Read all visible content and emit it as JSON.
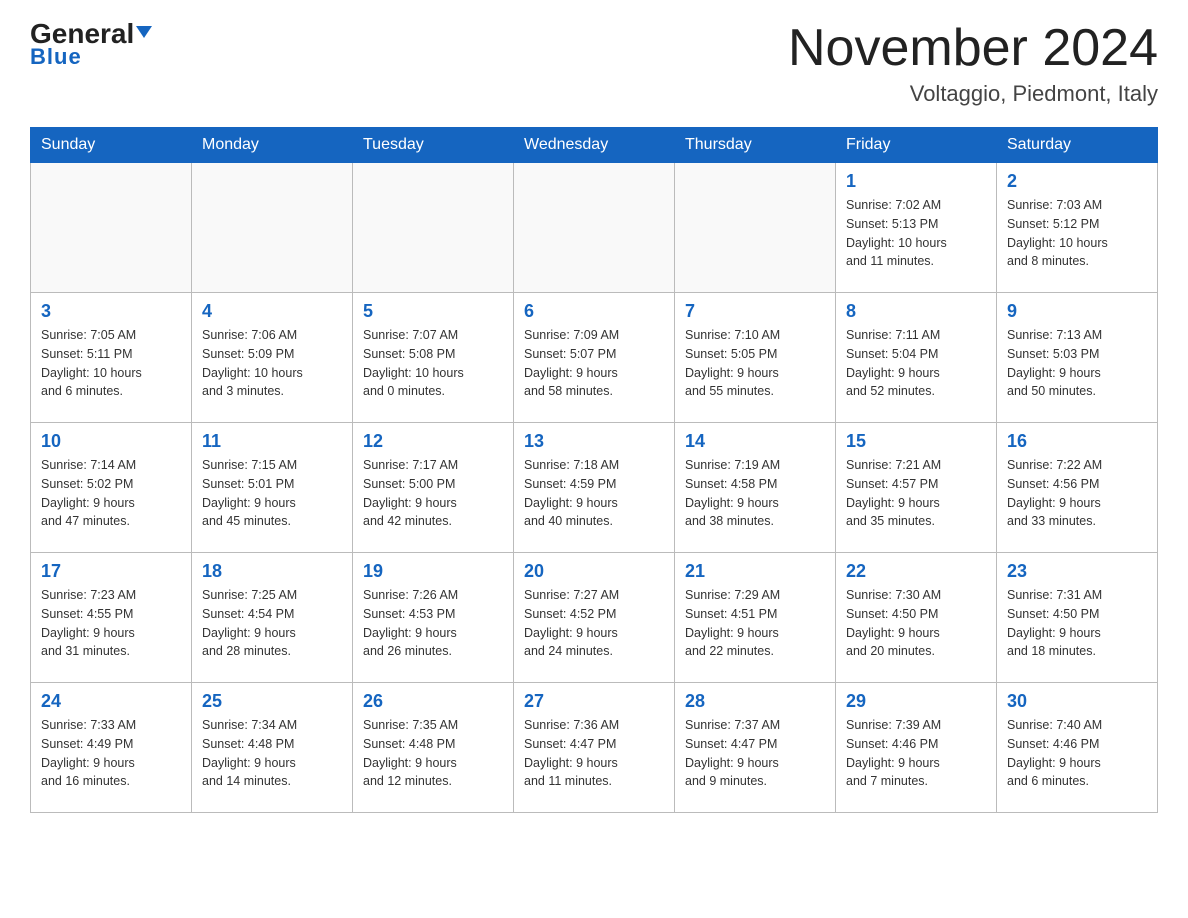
{
  "header": {
    "logo_general": "General",
    "logo_blue": "Blue",
    "month_title": "November 2024",
    "location": "Voltaggio, Piedmont, Italy"
  },
  "weekdays": [
    "Sunday",
    "Monday",
    "Tuesday",
    "Wednesday",
    "Thursday",
    "Friday",
    "Saturday"
  ],
  "weeks": [
    [
      {
        "day": "",
        "info": ""
      },
      {
        "day": "",
        "info": ""
      },
      {
        "day": "",
        "info": ""
      },
      {
        "day": "",
        "info": ""
      },
      {
        "day": "",
        "info": ""
      },
      {
        "day": "1",
        "info": "Sunrise: 7:02 AM\nSunset: 5:13 PM\nDaylight: 10 hours\nand 11 minutes."
      },
      {
        "day": "2",
        "info": "Sunrise: 7:03 AM\nSunset: 5:12 PM\nDaylight: 10 hours\nand 8 minutes."
      }
    ],
    [
      {
        "day": "3",
        "info": "Sunrise: 7:05 AM\nSunset: 5:11 PM\nDaylight: 10 hours\nand 6 minutes."
      },
      {
        "day": "4",
        "info": "Sunrise: 7:06 AM\nSunset: 5:09 PM\nDaylight: 10 hours\nand 3 minutes."
      },
      {
        "day": "5",
        "info": "Sunrise: 7:07 AM\nSunset: 5:08 PM\nDaylight: 10 hours\nand 0 minutes."
      },
      {
        "day": "6",
        "info": "Sunrise: 7:09 AM\nSunset: 5:07 PM\nDaylight: 9 hours\nand 58 minutes."
      },
      {
        "day": "7",
        "info": "Sunrise: 7:10 AM\nSunset: 5:05 PM\nDaylight: 9 hours\nand 55 minutes."
      },
      {
        "day": "8",
        "info": "Sunrise: 7:11 AM\nSunset: 5:04 PM\nDaylight: 9 hours\nand 52 minutes."
      },
      {
        "day": "9",
        "info": "Sunrise: 7:13 AM\nSunset: 5:03 PM\nDaylight: 9 hours\nand 50 minutes."
      }
    ],
    [
      {
        "day": "10",
        "info": "Sunrise: 7:14 AM\nSunset: 5:02 PM\nDaylight: 9 hours\nand 47 minutes."
      },
      {
        "day": "11",
        "info": "Sunrise: 7:15 AM\nSunset: 5:01 PM\nDaylight: 9 hours\nand 45 minutes."
      },
      {
        "day": "12",
        "info": "Sunrise: 7:17 AM\nSunset: 5:00 PM\nDaylight: 9 hours\nand 42 minutes."
      },
      {
        "day": "13",
        "info": "Sunrise: 7:18 AM\nSunset: 4:59 PM\nDaylight: 9 hours\nand 40 minutes."
      },
      {
        "day": "14",
        "info": "Sunrise: 7:19 AM\nSunset: 4:58 PM\nDaylight: 9 hours\nand 38 minutes."
      },
      {
        "day": "15",
        "info": "Sunrise: 7:21 AM\nSunset: 4:57 PM\nDaylight: 9 hours\nand 35 minutes."
      },
      {
        "day": "16",
        "info": "Sunrise: 7:22 AM\nSunset: 4:56 PM\nDaylight: 9 hours\nand 33 minutes."
      }
    ],
    [
      {
        "day": "17",
        "info": "Sunrise: 7:23 AM\nSunset: 4:55 PM\nDaylight: 9 hours\nand 31 minutes."
      },
      {
        "day": "18",
        "info": "Sunrise: 7:25 AM\nSunset: 4:54 PM\nDaylight: 9 hours\nand 28 minutes."
      },
      {
        "day": "19",
        "info": "Sunrise: 7:26 AM\nSunset: 4:53 PM\nDaylight: 9 hours\nand 26 minutes."
      },
      {
        "day": "20",
        "info": "Sunrise: 7:27 AM\nSunset: 4:52 PM\nDaylight: 9 hours\nand 24 minutes."
      },
      {
        "day": "21",
        "info": "Sunrise: 7:29 AM\nSunset: 4:51 PM\nDaylight: 9 hours\nand 22 minutes."
      },
      {
        "day": "22",
        "info": "Sunrise: 7:30 AM\nSunset: 4:50 PM\nDaylight: 9 hours\nand 20 minutes."
      },
      {
        "day": "23",
        "info": "Sunrise: 7:31 AM\nSunset: 4:50 PM\nDaylight: 9 hours\nand 18 minutes."
      }
    ],
    [
      {
        "day": "24",
        "info": "Sunrise: 7:33 AM\nSunset: 4:49 PM\nDaylight: 9 hours\nand 16 minutes."
      },
      {
        "day": "25",
        "info": "Sunrise: 7:34 AM\nSunset: 4:48 PM\nDaylight: 9 hours\nand 14 minutes."
      },
      {
        "day": "26",
        "info": "Sunrise: 7:35 AM\nSunset: 4:48 PM\nDaylight: 9 hours\nand 12 minutes."
      },
      {
        "day": "27",
        "info": "Sunrise: 7:36 AM\nSunset: 4:47 PM\nDaylight: 9 hours\nand 11 minutes."
      },
      {
        "day": "28",
        "info": "Sunrise: 7:37 AM\nSunset: 4:47 PM\nDaylight: 9 hours\nand 9 minutes."
      },
      {
        "day": "29",
        "info": "Sunrise: 7:39 AM\nSunset: 4:46 PM\nDaylight: 9 hours\nand 7 minutes."
      },
      {
        "day": "30",
        "info": "Sunrise: 7:40 AM\nSunset: 4:46 PM\nDaylight: 9 hours\nand 6 minutes."
      }
    ]
  ]
}
